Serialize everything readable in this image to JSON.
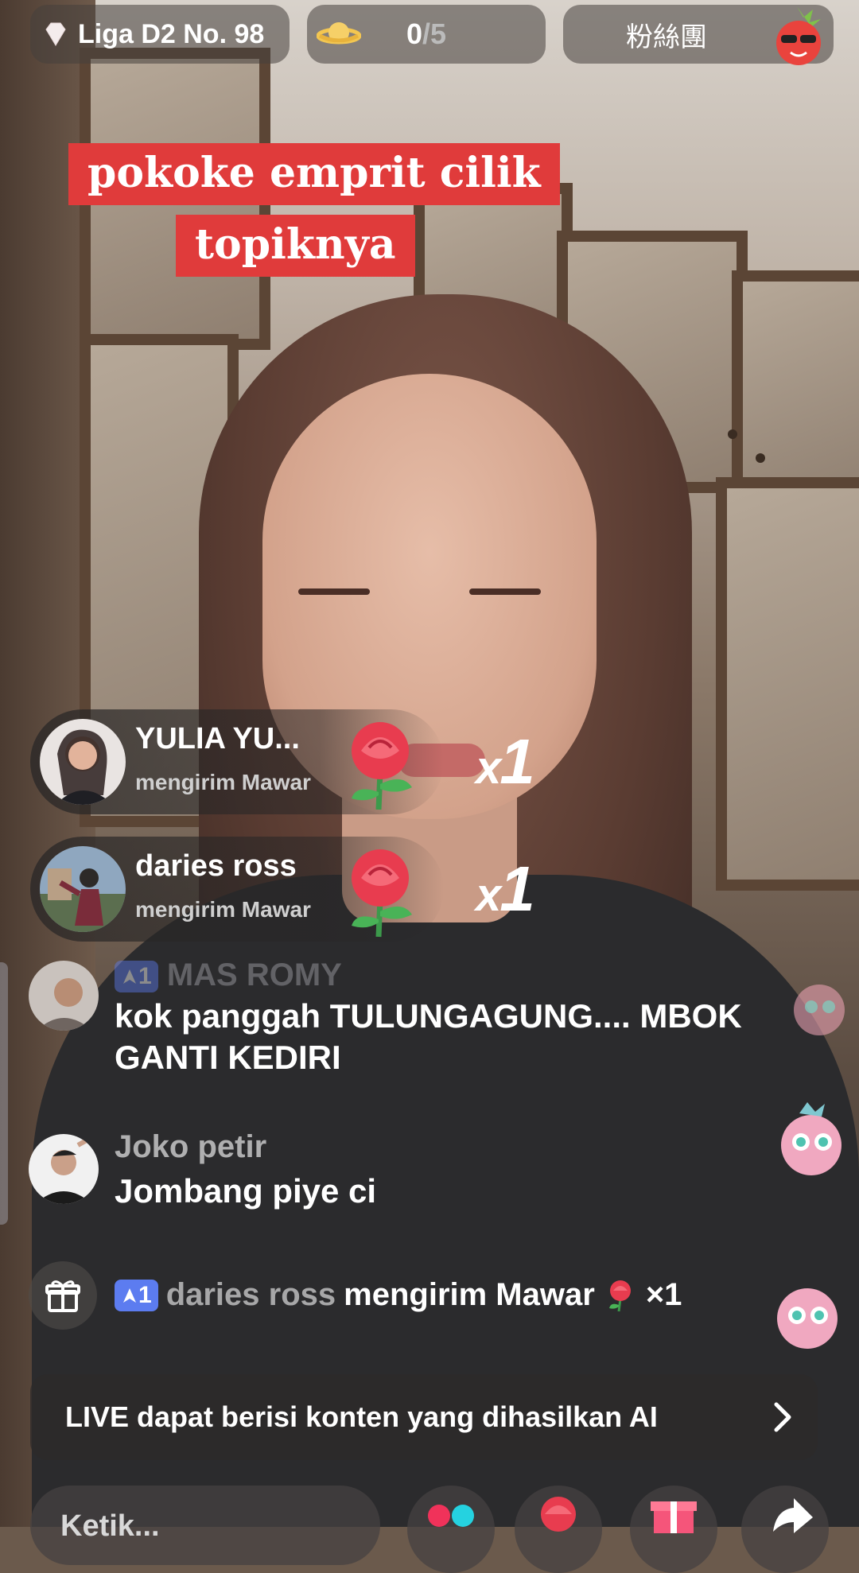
{
  "top_bar": {
    "league_label": "Liga D2 No. 98",
    "score_current": "0",
    "score_separator": "/",
    "score_total": "5",
    "fans_label": "粉絲團"
  },
  "topic": {
    "line1": "pokoke emprit cilik",
    "line2": "topiknya"
  },
  "gifts": [
    {
      "name": "YULIA YU...",
      "action": "mengirim Mawar",
      "x": "x",
      "count": "1"
    },
    {
      "name": "daries ross",
      "action": "mengirim Mawar",
      "x": "x",
      "count": "1"
    }
  ],
  "chat": [
    {
      "badge": "1",
      "name": "MAS ROMY",
      "message": "kok panggah TULUNGAGUNG.... MBOK GANTI KEDIRI"
    },
    {
      "name": "Joko petir",
      "message": "Jombang piye ci"
    }
  ],
  "gift_line": {
    "badge": "1",
    "name": "daries ross",
    "action": "mengirim Mawar",
    "count": "×1"
  },
  "notice": {
    "text": "LIVE dapat berisi konten yang dihasilkan AI"
  },
  "input": {
    "placeholder": "Ketik..."
  },
  "colors": {
    "topic_red": "#e03b3b",
    "badge_blue": "#5c7cf0"
  },
  "icons": [
    "diamond-icon",
    "planet-icon",
    "rose-icon",
    "gift-icon",
    "chevron-right-icon",
    "share-icon"
  ]
}
